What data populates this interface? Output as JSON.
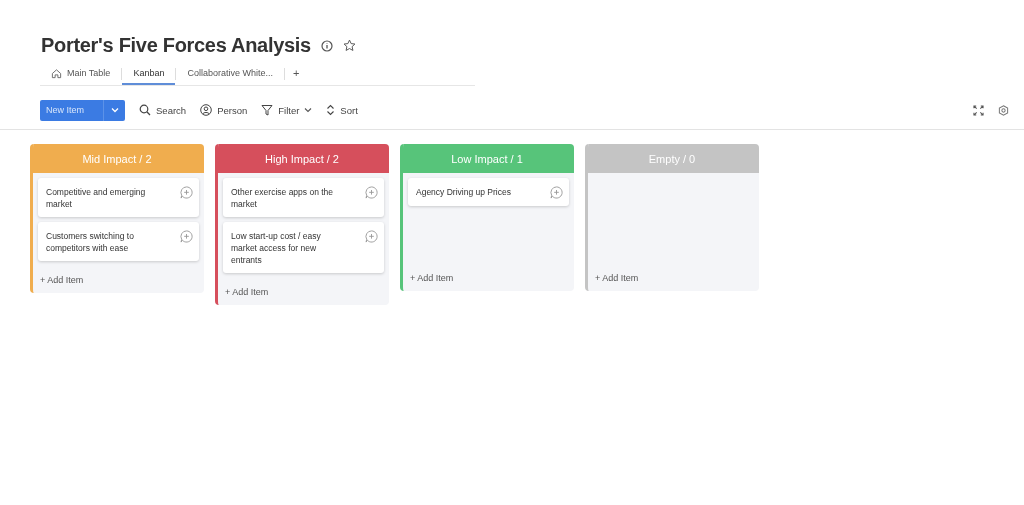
{
  "board": {
    "title": "Porter's Five Forces Analysis"
  },
  "tabs": [
    {
      "label": "Main Table",
      "selected": false,
      "kind": "home"
    },
    {
      "label": "Kanban",
      "selected": true,
      "kind": "plain"
    },
    {
      "label": "Collaborative White...",
      "selected": false,
      "kind": "plain"
    },
    {
      "label": "+",
      "selected": false,
      "kind": "add"
    }
  ],
  "toolbar": {
    "new_item": "New Item",
    "items": [
      {
        "label": "Search",
        "kind": "search"
      },
      {
        "label": "Person",
        "kind": "person"
      },
      {
        "label": "Filter",
        "kind": "filter"
      },
      {
        "label": "Sort",
        "kind": "sort"
      }
    ]
  },
  "columns": [
    {
      "title": "Mid Impact / 2",
      "color": "#f0ad4e",
      "cards": [
        "Competitive and emerging market",
        "Customers switching to competitors with ease"
      ],
      "add_label": "+ Add Item"
    },
    {
      "title": "High Impact / 2",
      "color": "#d64f5c",
      "cards": [
        "Other exercise apps on the market",
        "Low start-up cost / easy market access for new entrants"
      ],
      "add_label": "+ Add Item"
    },
    {
      "title": "Low Impact / 1",
      "color": "#57c47a",
      "cards": [
        "Agency Driving up Prices"
      ],
      "add_label": "+ Add Item"
    },
    {
      "title": "Empty / 0",
      "color": "#c4c4c4",
      "add_label": "+ Add Item"
    }
  ]
}
